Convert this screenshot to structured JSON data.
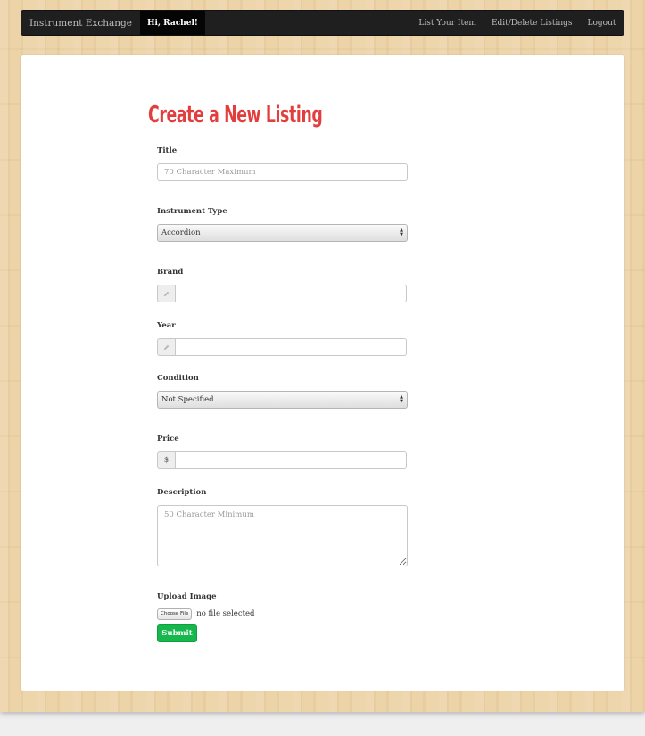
{
  "navbar": {
    "brand": "Instrument Exchange",
    "greeting": "Hi, Rachel!",
    "links": [
      {
        "label": "List Your Item"
      },
      {
        "label": "Edit/Delete Listings"
      },
      {
        "label": "Logout"
      }
    ]
  },
  "form": {
    "heading": "Create a New Listing",
    "title": {
      "label": "Title",
      "placeholder": "70 Character Maximum",
      "value": ""
    },
    "instrument_type": {
      "label": "Instrument Type",
      "selected": "Accordion"
    },
    "brand": {
      "label": "Brand",
      "addon_icon": "pencil-icon",
      "value": ""
    },
    "year": {
      "label": "Year",
      "addon_icon": "pencil-icon",
      "value": ""
    },
    "condition": {
      "label": "Condition",
      "selected": "Not Specified"
    },
    "price": {
      "label": "Price",
      "addon": "$",
      "value": ""
    },
    "description": {
      "label": "Description",
      "placeholder": "50 Character Minimum",
      "value": ""
    },
    "upload": {
      "label": "Upload Image",
      "button": "Choose File",
      "status": "no file selected"
    },
    "submit_label": "Submit"
  },
  "colors": {
    "heading": "#e33e3e",
    "submit": "#16b84e",
    "navbar": "#1f1f1f",
    "background_wood": "#ecd3a8"
  }
}
